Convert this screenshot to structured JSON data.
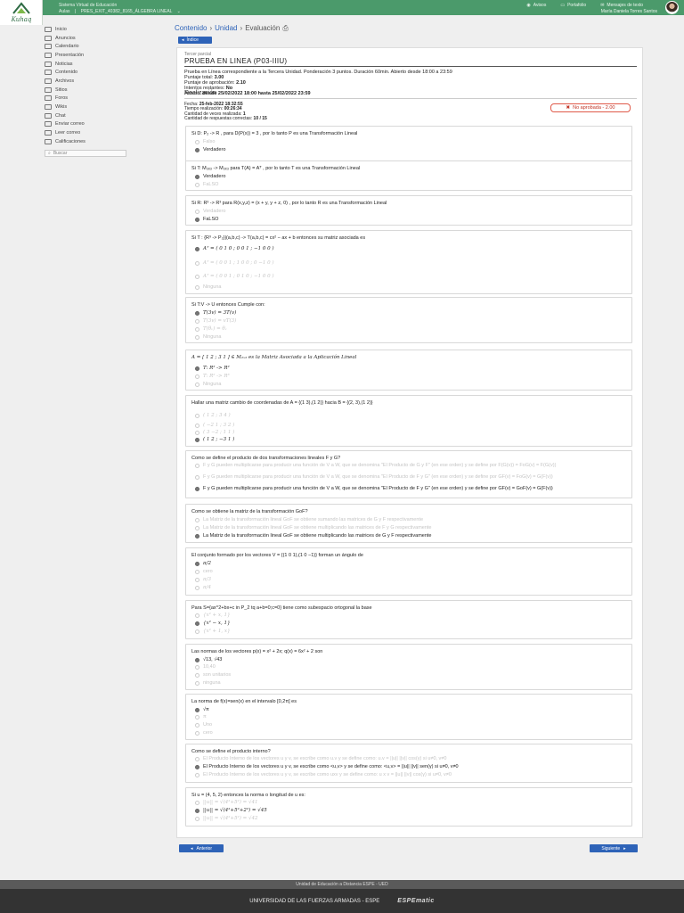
{
  "topbar": {
    "site_title": "Sistema Virtual de Educación",
    "course_prefix": "Aulas",
    "course_name": "PRES_EXIT_40382_8165_ÁLGEBRA LINEAL",
    "links": [
      "Avisos",
      "Portafolio",
      "Mensajes de texto"
    ],
    "user_name": "María Daniela Torres Santos"
  },
  "logo_text": "Kuhaq",
  "sidebar": {
    "items": [
      "Inicio",
      "Anuncios",
      "Calendario",
      "Presentación",
      "Noticias",
      "Contenido",
      "Archivos",
      "Sitios",
      "Foros",
      "Wikis",
      "Chat",
      "Enviar correo",
      "Leer correo",
      "Calificaciones"
    ],
    "search_label": "Buscar"
  },
  "breadcrumb": {
    "items": [
      "Contenido",
      "Unidad",
      "Evaluación"
    ]
  },
  "indice_label": "Índice",
  "panel": {
    "small": "Tercer parcial",
    "title": "PRUEBA EN LINEA (P03-IIIU)",
    "description": "Prueba en Línea correspondiente a la Tercera Unidad. Ponderación 3 puntos. Duración 60min. Abierto desde 18:00 a 23:59",
    "info": [
      {
        "label": "Puntaje total:",
        "value": "3.00"
      },
      {
        "label": "Puntaje de aprobación:",
        "value": "2.10"
      },
      {
        "label": "Intentos restantes:",
        "value": "No"
      },
      {
        "label": "Abierto:",
        "value": "desde 25/02/2022 18:00 hasta 25/02/2022 23:59"
      }
    ],
    "realizacion": "Realización",
    "results": [
      {
        "label": "Fecha:",
        "value": "25-feb-2022 18:32:55"
      },
      {
        "label": "Tiempo realización:",
        "value": "00:26:34"
      },
      {
        "label": "Cantidad de veces realizada:",
        "value": "1"
      },
      {
        "label": "Cantidad de respuestas correctas:",
        "value": "10 / 15"
      }
    ],
    "badge": "No aprobada - 2.00"
  },
  "questions": [
    {
      "text": "Si D: P₂ -> R , para D(P(x)) = 3 , por lo tanto P es una Transformación Lineal",
      "options": [
        {
          "text": "Falso",
          "selected": false
        },
        {
          "text": "Verdadero",
          "selected": true
        }
      ]
    },
    {
      "text": "Si T: M₃ₓ₃ -> M₃ₓ₃ para T(A) = Aᵀ , por lo tanto T es una Transformación Lineal",
      "options": [
        {
          "text": "Verdadero",
          "selected": true
        },
        {
          "text": "FaLSO",
          "selected": false
        }
      ]
    },
    {
      "text": "Si R: R³ -> R³ para R(x,y,z) = (x + y, y + z, 0) , por lo tanto R es una Transformación Lineal",
      "options": [
        {
          "text": "Verdadero",
          "selected": false
        },
        {
          "text": "FaLSO",
          "selected": true
        }
      ]
    },
    {
      "text": "Si T : {R³ -> P₂}|(a,b,c) -> T(a,b,c) = cx² − ax + b entonces su matriz asociada es",
      "options": [
        {
          "text": "Aᵀ = ( 0 1 0 ; 0 0 1 ; −1 0 0 )",
          "selected": true
        },
        {
          "text": "Aᵀ = ( 0 0 1 ; 1 0 0 ; 0 −1 0 )",
          "selected": false
        },
        {
          "text": "Aᵀ = ( 0 0 1 ; 0 1 0 ; −1 0 0 )",
          "selected": false
        },
        {
          "text": "Ninguna",
          "selected": false
        }
      ]
    },
    {
      "text": "Si T:V -> U entonces Cumple con:",
      "options": [
        {
          "text": "T(3v) = 3T(v)",
          "selected": true
        },
        {
          "text": "T(3v) = vT(3)",
          "selected": false
        },
        {
          "text": "T(θᵥ) = θᵥ",
          "selected": false
        },
        {
          "text": "Ninguna",
          "selected": false
        }
      ]
    },
    {
      "text": "A = [ 1 2 ; 3 1 ] ∈ M₂ₓ₂ es la Matriz Asociada a la Aplicación Lineal",
      "options": [
        {
          "text": "T: R² -> R²",
          "selected": true
        },
        {
          "text": "T: R² -> R³",
          "selected": false
        },
        {
          "text": "Ninguna",
          "selected": false
        }
      ]
    },
    {
      "text": "Hallar una matriz cambio de coordenadas de A = {(1 3),(1 2)} hacia B = {(2, 3),(1 2)}",
      "options": [
        {
          "text": "( 1 2 ; 3 4 )",
          "selected": false
        },
        {
          "text": "( −2 1 ; 3 2 )",
          "selected": false
        },
        {
          "text": "( 3 −2 ; 1 1 )",
          "selected": false
        },
        {
          "text": "( 1 2 ; −3 1 )",
          "selected": true
        }
      ]
    },
    {
      "text": "Como se define el producto de dos transformaciones lineales F y G?",
      "options": [
        {
          "text": "F y G pueden multiplicarse para producir una función de V a W, que se denomina \"El Producto de G y F\" (en ese orden) y se define por F(G(v)) = FoG(v) = F(G(v))",
          "selected": false
        },
        {
          "text": "F y G pueden multiplicarse para producir una función de V a W, que se denomina \"El Producto de F y G\" (en ese orden) y se define por GF(v) = FoG(v) = G(F(v))",
          "selected": false
        },
        {
          "text": "F y G pueden multiplicarse para producir una función de V a W, que se denomina \"El Producto de F y G\" (en ese orden) y se define por GF(v) = GoF(v) = G(F(v))",
          "selected": true
        }
      ]
    },
    {
      "text": "Como se obtiene la matriz de la transformación GoF?",
      "options": [
        {
          "text": "La Matriz de la transformación lineal GoF se obtiene sumando las matrices de G y F respectivamente",
          "selected": false
        },
        {
          "text": "La Matriz de la transformación lineal GoF se obtiene multiplicando las matrices de F y G respectivamente",
          "selected": false
        },
        {
          "text": "La Matriz de la transformación lineal GoF se obtiene multiplicando las matrices de G y F respectivamente",
          "selected": true
        }
      ]
    },
    {
      "text": "El conjunto formado por los vectores V = {(1 0 1),(1 0 −1)} forman un ángulo de",
      "options": [
        {
          "text": "π/2",
          "selected": true
        },
        {
          "text": "cero",
          "selected": false
        },
        {
          "text": "π/3",
          "selected": false
        },
        {
          "text": "π/4",
          "selected": false
        }
      ]
    },
    {
      "text": "Para S={ax^2+bx+c in P_2 tq a+b=0;c=0} tiene como subespacio ortogonal la base",
      "options": [
        {
          "text": "{x² + x, 1}",
          "selected": false
        },
        {
          "text": "{x² − x, 1}",
          "selected": true
        },
        {
          "text": "{x² + 1, x}",
          "selected": false
        }
      ]
    },
    {
      "text": "Las normas de los vectores p(x) = x² + 2x; q(x) = 6x² + 2 son",
      "options": [
        {
          "text": "√13, √43",
          "selected": true
        },
        {
          "text": "10,40",
          "selected": false
        },
        {
          "text": "son unitarios",
          "selected": false
        },
        {
          "text": "ninguna",
          "selected": false
        }
      ]
    },
    {
      "text": "La norma de f(x)=sen(x) en el intervalo [0,2π] es",
      "options": [
        {
          "text": "√π",
          "selected": true
        },
        {
          "text": "π",
          "selected": false
        },
        {
          "text": "Uno",
          "selected": false
        },
        {
          "text": "cero",
          "selected": false
        }
      ]
    },
    {
      "text": "Como se define el producto interno?",
      "options": [
        {
          "text": "El Producto Interno de los vectores u y v, se escribe como u.v y se define como: u.v = ||u|| ||v|| cos(γ) si u≠0, v≠0",
          "selected": false
        },
        {
          "text": "El Producto Interno de los vectores u y v, se escribe como <u,v> y se define como: <u,v> = ||u|| ||v|| sen(γ) si u≠0, v≠0",
          "selected": true
        },
        {
          "text": "El Producto Interno de los vectores u y v, se escribe como uxv y se define como: u x v = ||u|| ||v|| cos(γ) si u≠0, v≠0",
          "selected": false
        }
      ]
    },
    {
      "text": "Si u = (4, 5, 2) entonces la norma o longitud de u es:",
      "options": [
        {
          "text": "||u|| = √(4²+5²) = √41",
          "selected": false
        },
        {
          "text": "||u|| = √(4²+5²+2²) = √45",
          "selected": true
        },
        {
          "text": "||u|| = √(4²+5²) = √42",
          "selected": false
        }
      ]
    }
  ],
  "buttons": {
    "prev": "Anterior",
    "next": "Siguiente"
  },
  "footer": {
    "line1": "Unidad de Educación a Distancia ESPE - UED",
    "line2": "UNIVERSIDAD DE LAS FUERZAS ARMADAS - ESPE",
    "brand": "ESPEmatic"
  },
  "colors": {
    "topbar": "#4b9a6b",
    "link": "#2e63b8",
    "badge_border": "#e05a4a"
  }
}
